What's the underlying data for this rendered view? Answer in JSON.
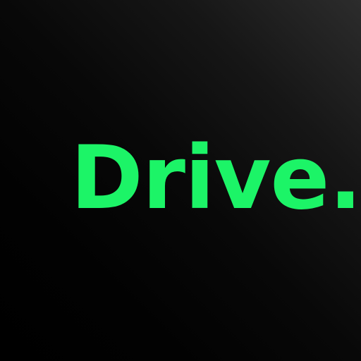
{
  "app_icon": {
    "wordmark": "Drive.",
    "colors": {
      "text": "#1cf467",
      "background_dark": "#000000",
      "background_light": "#2c2c2c"
    }
  }
}
